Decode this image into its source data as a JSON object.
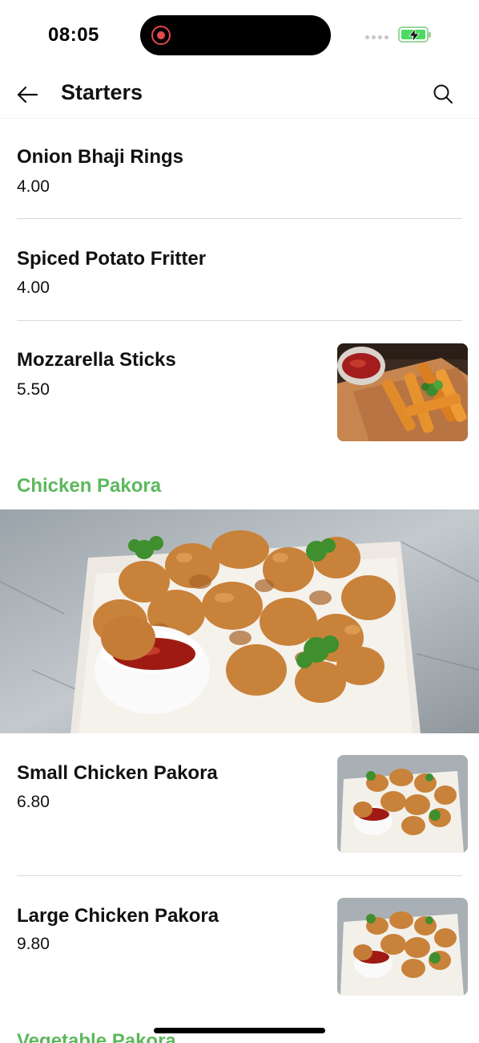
{
  "status_bar": {
    "time": "08:05"
  },
  "header": {
    "title": "Starters",
    "back_icon": "arrow-left-icon",
    "search_icon": "search-icon"
  },
  "items_group1": [
    {
      "name": "Onion Bhaji Rings",
      "price": "4.00"
    },
    {
      "name": "Spiced Potato Fritter",
      "price": "4.00"
    },
    {
      "name": "Mozzarella Sticks",
      "price": "5.50",
      "image": "mozzarella-sticks-photo"
    }
  ],
  "section_chicken": {
    "title": "Chicken Pakora",
    "image": "chicken-pakora-hero-photo"
  },
  "items_group2": [
    {
      "name": "Small Chicken Pakora",
      "price": "6.80",
      "image": "chicken-pakora-photo"
    },
    {
      "name": "Large Chicken Pakora",
      "price": "9.80",
      "image": "chicken-pakora-photo"
    }
  ],
  "section_vegetable": {
    "title": "Vegetable Pakora"
  },
  "colors": {
    "accent_green": "#5cb85c",
    "text": "#111111",
    "divider": "#d8d8d8"
  }
}
